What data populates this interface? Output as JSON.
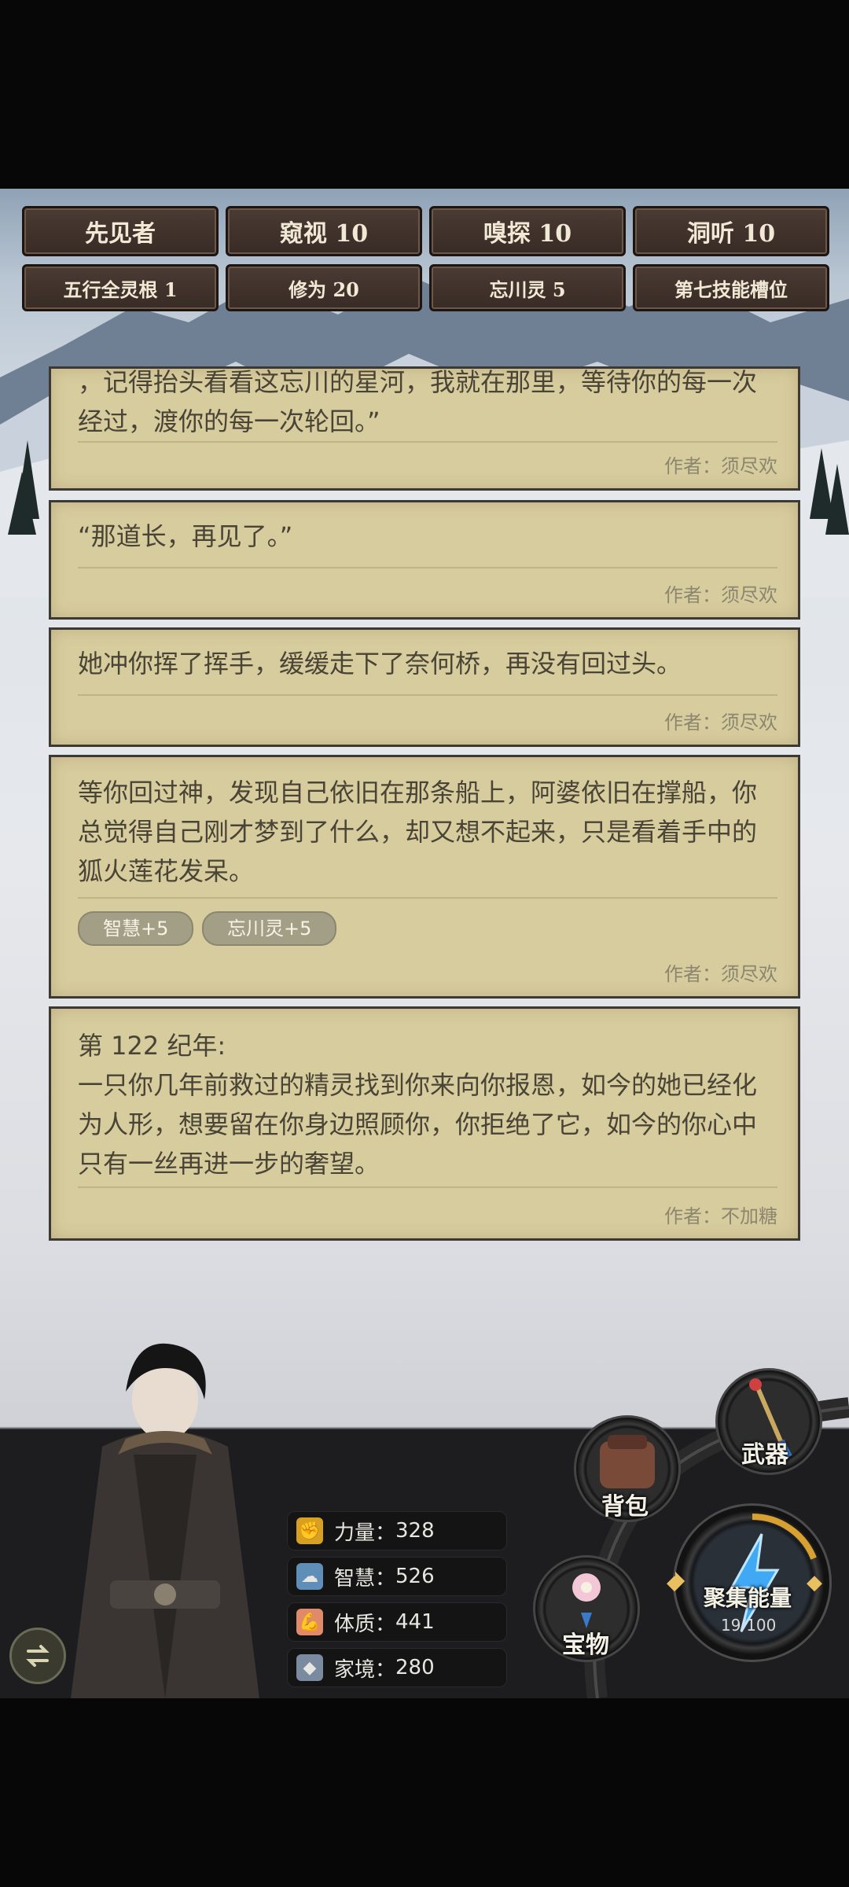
{
  "tags_row1": [
    "先见者",
    "窥视 10",
    "嗅探 10",
    "洞听 10"
  ],
  "tags_row2": [
    "五行全灵根 1",
    "修为 20",
    "忘川灵 5",
    "第七技能槽位"
  ],
  "cards": [
    {
      "text": "，记得抬头看看这忘川的星河，我就在那里，等待你的每一次经过，渡你的每一次轮回。”",
      "author": "作者：须尽欢"
    },
    {
      "text": "“那道长，再见了。”",
      "author": "作者：须尽欢"
    },
    {
      "text": "她冲你挥了挥手，缓缓走下了奈何桥，再没有回过头。",
      "author": "作者：须尽欢"
    },
    {
      "text": "等你回过神，发现自己依旧在那条船上，阿婆依旧在撑船，你总觉得自己刚才梦到了什么，却又想不起来，只是看着手中的狐火莲花发呆。",
      "chips": [
        "智慧+5",
        "忘川灵+5"
      ],
      "author": "作者：须尽欢"
    },
    {
      "year": "第 122 纪年:",
      "text": "一只你几年前救过的精灵找到你来向你报恩，如今的她已经化为人形，想要留在你身边照顾你，你拒绝了它，如今的你心中只有一丝再进一步的奢望。",
      "author": "作者：不加糖"
    }
  ],
  "stats": [
    {
      "label": "力量：",
      "value": "328",
      "icon": "fist-icon"
    },
    {
      "label": "智慧：",
      "value": "526",
      "icon": "brain-icon"
    },
    {
      "label": "体质：",
      "value": "441",
      "icon": "muscle-icon"
    },
    {
      "label": "家境：",
      "value": "280",
      "icon": "diamond-icon"
    }
  ],
  "buttons": {
    "weapon": "武器",
    "bag": "背包",
    "treasure": "宝物",
    "gather": "聚集能量",
    "energy": "19/100"
  },
  "energy_fraction": 0.19,
  "colors": {
    "card_bg": "#d7cc9e",
    "tag_bg": "#4a3b33",
    "energy_blue": "#3fa9f5"
  }
}
